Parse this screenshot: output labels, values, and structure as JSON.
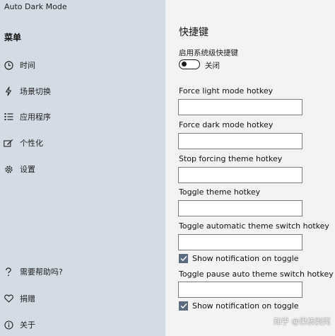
{
  "app": {
    "title": "Auto Dark Mode"
  },
  "sidebar": {
    "heading": "菜单",
    "items": [
      {
        "label": "时间",
        "icon": "clock-icon"
      },
      {
        "label": "场景切换",
        "icon": "lightning-icon"
      },
      {
        "label": "应用程序",
        "icon": "list-icon"
      },
      {
        "label": "个性化",
        "icon": "paint-icon"
      },
      {
        "label": "设置",
        "icon": "gear-icon"
      }
    ],
    "footer_items": [
      {
        "label": "需要帮助吗?",
        "icon": "question-icon"
      },
      {
        "label": "捐赠",
        "icon": "heart-icon"
      },
      {
        "label": "关于",
        "icon": "info-icon"
      }
    ]
  },
  "main": {
    "title": "快捷键",
    "system_hotkeys": {
      "label": "启用系统级快捷键",
      "state_label": "关闭",
      "enabled": false
    },
    "fields": [
      {
        "label": "Force light mode hotkey",
        "value": ""
      },
      {
        "label": "Force dark mode hotkey",
        "value": ""
      },
      {
        "label": "Stop forcing theme hotkey",
        "value": ""
      },
      {
        "label": "Toggle theme hotkey",
        "value": ""
      },
      {
        "label": "Toggle automatic theme switch hotkey",
        "value": ""
      },
      {
        "label": "Toggle pause auto theme switch hotkey",
        "value": ""
      }
    ],
    "checkboxes": [
      {
        "label": "Show notification on toggle",
        "checked": true
      },
      {
        "label": "Show notification on toggle",
        "checked": true
      }
    ]
  },
  "watermark": "知乎 @果核剥壳",
  "colors": {
    "sidebar_bg": "#d3dbe5",
    "content_bg": "#f3f3f3",
    "checkbox_fill": "#5a6b7f"
  }
}
